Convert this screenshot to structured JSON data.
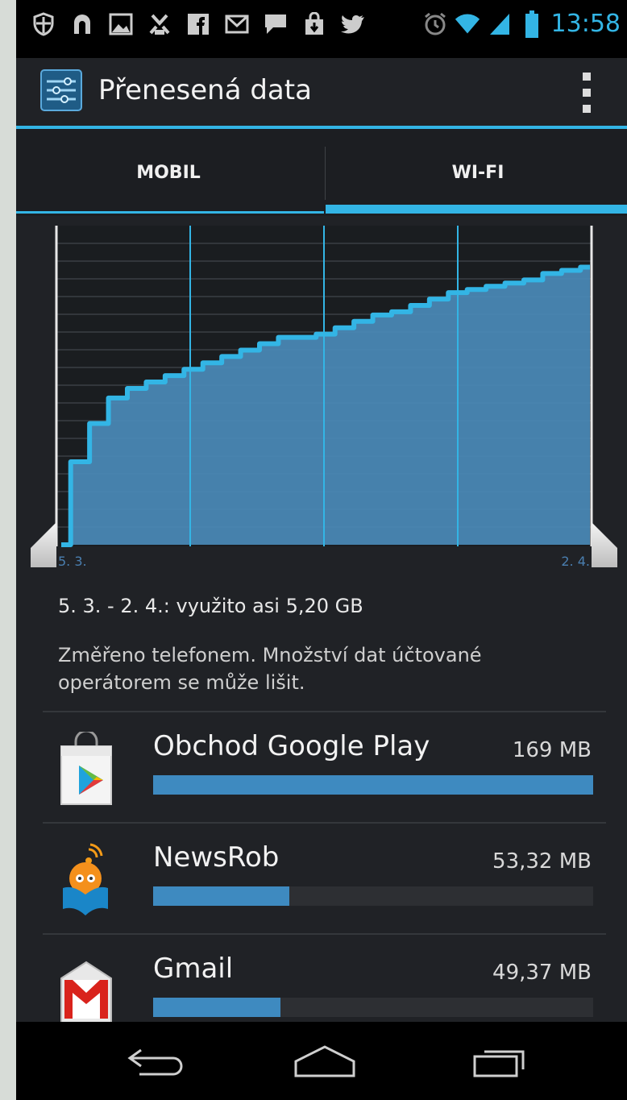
{
  "status_bar": {
    "time": "13:58",
    "notification_icons": [
      "shield-icon",
      "unknown-app-icon",
      "gallery-icon",
      "tasks-icon",
      "facebook-icon",
      "gmail-icon",
      "chat-icon",
      "shopping-bag-icon",
      "twitter-icon"
    ],
    "system_icons": [
      "alarm-icon",
      "wifi-icon",
      "signal-icon",
      "battery-icon"
    ],
    "accent": "#33b5e5"
  },
  "action_bar": {
    "title": "Přenesená data",
    "app_icon": "settings-icon",
    "overflow_icon": "overflow-menu-icon"
  },
  "tabs": [
    {
      "label": "MOBIL",
      "selected": false
    },
    {
      "label": "WI-FI",
      "selected": true
    }
  ],
  "chart_data": {
    "type": "area",
    "x_start_label": "5. 3.",
    "x_end_label": "2. 4.",
    "x_days": [
      0,
      1,
      2,
      3,
      4,
      5,
      6,
      7,
      8,
      9,
      10,
      11,
      12,
      13,
      14,
      15,
      16,
      17,
      18,
      19,
      20,
      21,
      22,
      23,
      24,
      25,
      26,
      27,
      28
    ],
    "cumulative_fraction": [
      0.0,
      0.26,
      0.38,
      0.46,
      0.49,
      0.51,
      0.53,
      0.55,
      0.57,
      0.59,
      0.61,
      0.63,
      0.65,
      0.65,
      0.66,
      0.68,
      0.7,
      0.72,
      0.73,
      0.75,
      0.77,
      0.79,
      0.8,
      0.81,
      0.82,
      0.83,
      0.85,
      0.86,
      0.87
    ],
    "grid": true,
    "color": "#33b5e5",
    "fill": "#4a8ab8"
  },
  "summary": "5. 3. - 2. 4.: využito asi 5,20 GB",
  "notice": "Změřeno telefonem. Množství dat účtované operátorem se může lišit.",
  "apps": [
    {
      "name": "Obchod Google Play",
      "size": "169 MB",
      "usage_fraction": 1.0,
      "icon": "google-play-icon"
    },
    {
      "name": "NewsRob",
      "size": "53,32 MB",
      "usage_fraction": 0.31,
      "icon": "newsrob-icon"
    },
    {
      "name": "Gmail",
      "size": "49,37 MB",
      "usage_fraction": 0.29,
      "icon": "gmail-icon"
    }
  ],
  "nav_bar": {
    "buttons": [
      "back-icon",
      "home-icon",
      "recents-icon"
    ]
  }
}
